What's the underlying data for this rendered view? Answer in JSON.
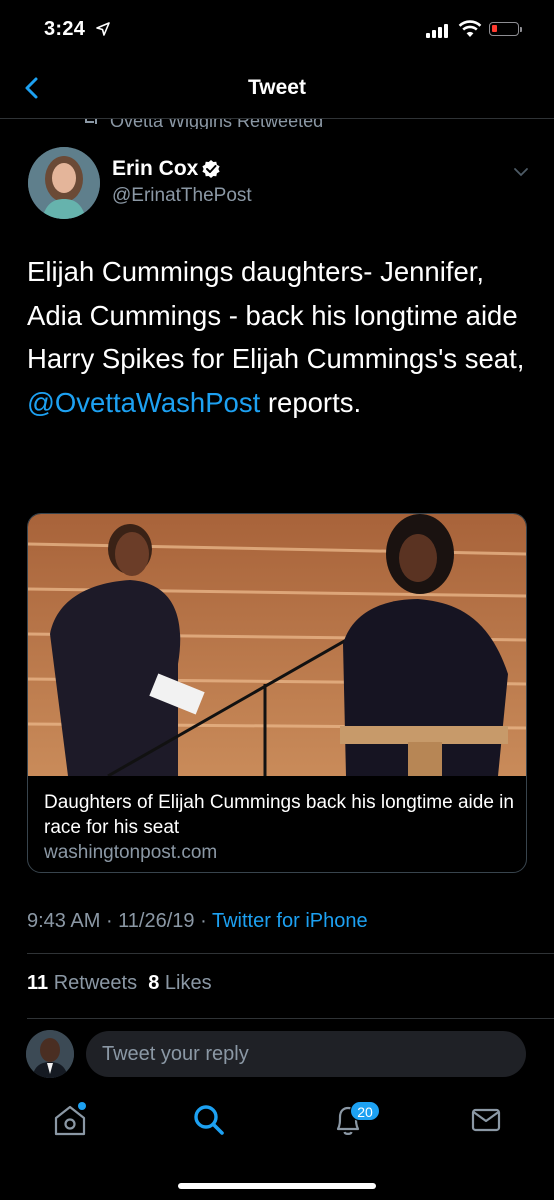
{
  "status_bar": {
    "time": "3:24"
  },
  "nav": {
    "title": "Tweet"
  },
  "retweet_header": "Ovetta Wiggins Retweeted",
  "author": {
    "name": "Erin Cox",
    "handle": "@ErinatThePost"
  },
  "tweet": {
    "text_before": "Elijah Cummings daughters- Jennifer, Adia Cummings - back his longtime aide Harry Spikes for Elijah Cummings's seat, ",
    "mention": "@OvettaWashPost",
    "text_after": " reports."
  },
  "card": {
    "title": "Daughters of Elijah Cummings back his longtime aide in race for his seat",
    "domain": "washingtonpost.com"
  },
  "meta": {
    "time": "9:43 AM",
    "sep1": " · ",
    "date": "11/26/19",
    "sep2": " · ",
    "source": "Twitter for iPhone"
  },
  "stats": {
    "retweets_count": "11",
    "retweets_label": "Retweets",
    "likes_count": "8",
    "likes_label": "Likes"
  },
  "reply": {
    "placeholder": "Tweet your reply"
  },
  "tabbar": {
    "notifications_badge": "20",
    "icons": [
      "home-icon",
      "search-icon",
      "notifications-icon",
      "messages-icon"
    ]
  },
  "colors": {
    "accent": "#1da1f2",
    "background": "#000000",
    "secondary_text": "#8b98a5",
    "divider": "#2f3336"
  }
}
